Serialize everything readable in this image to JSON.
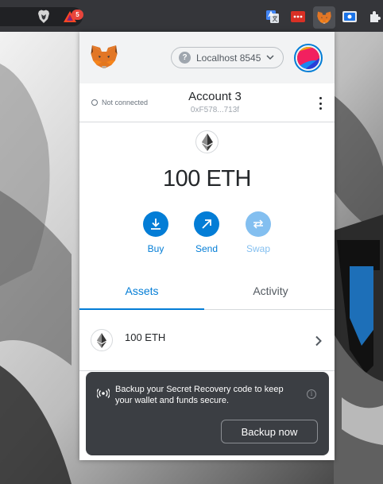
{
  "browser": {
    "bat_badge_count": "5",
    "extensions": [
      "google-translate-icon",
      "red-dots-extension-icon",
      "metamask-fox-icon",
      "blue-screen-extension-icon",
      "puzzle-icon"
    ]
  },
  "popup": {
    "network": {
      "indicator": "?",
      "name": "Localhost 8545"
    },
    "account": {
      "connection_status": "Not connected",
      "name": "Account 3",
      "address": "0xF578...713f"
    },
    "balance": "100 ETH",
    "actions": [
      {
        "label": "Buy",
        "icon": "download-icon",
        "enabled": true
      },
      {
        "label": "Send",
        "icon": "arrow-up-right-icon",
        "enabled": true
      },
      {
        "label": "Swap",
        "icon": "swap-arrows-icon",
        "enabled": false
      }
    ],
    "tabs": [
      {
        "label": "Assets",
        "active": true
      },
      {
        "label": "Activity",
        "active": false
      }
    ],
    "assets": [
      {
        "name": "100 ETH",
        "icon": "ethereum-icon"
      }
    ]
  },
  "toast": {
    "message": "Backup your Secret Recovery code to keep your wallet and funds secure.",
    "button_label": "Backup now",
    "info_glyph": "i"
  },
  "colors": {
    "accent": "#037dd6",
    "disabled_accent": "#83bff0",
    "toast_background": "#3b3e43"
  }
}
